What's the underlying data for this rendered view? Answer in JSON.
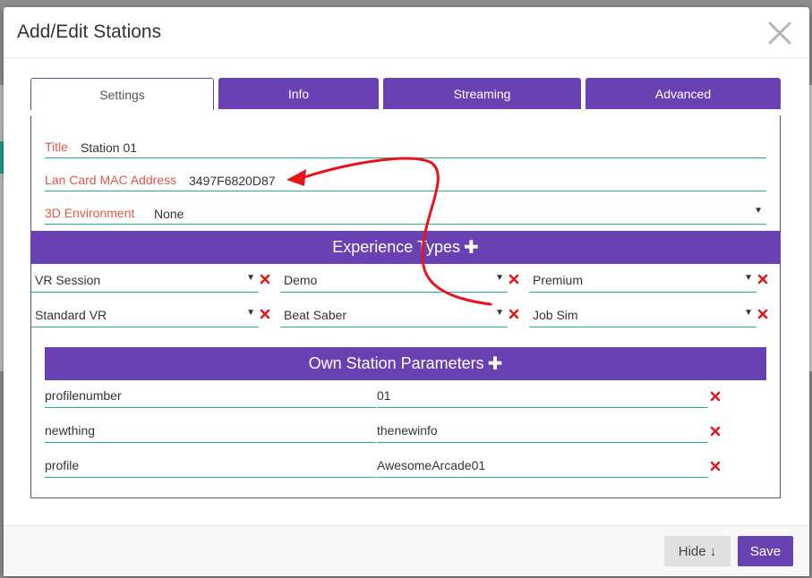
{
  "modal": {
    "title": "Add/Edit Stations",
    "close_icon": "close-icon"
  },
  "tabs": [
    {
      "label": "Settings",
      "active": true
    },
    {
      "label": "Info",
      "active": false
    },
    {
      "label": "Streaming",
      "active": false
    },
    {
      "label": "Advanced",
      "active": false
    }
  ],
  "settings": {
    "title_label": "Title",
    "title_value": "Station 01",
    "mac_label": "Lan Card MAC Address",
    "mac_value": "3497F6820D87",
    "env_label": "3D Environment",
    "env_value": "None"
  },
  "experience_types": {
    "header": "Experience Types",
    "plus": "✚",
    "items": [
      "VR Session",
      "Demo",
      "Premium",
      "Standard VR",
      "Beat Saber",
      "Job Sim"
    ]
  },
  "own_station_parameters": {
    "header": "Own Station Parameters",
    "plus": "✚",
    "rows": [
      {
        "key": "profilenumber",
        "value": "01"
      },
      {
        "key": "newthing",
        "value": "thenewinfo"
      },
      {
        "key": "profile",
        "value": "AwesomeArcade01"
      }
    ]
  },
  "footer": {
    "hide_label": "Hide ↓",
    "save_label": "Save"
  },
  "colors": {
    "accent": "#6a41b2",
    "underline": "#1fb291",
    "label": "#e4564a",
    "delete": "#e0191f",
    "annotation_arrow": "#e8121b"
  },
  "icons": {
    "caret": "▼",
    "delete": "delete-x-icon"
  }
}
